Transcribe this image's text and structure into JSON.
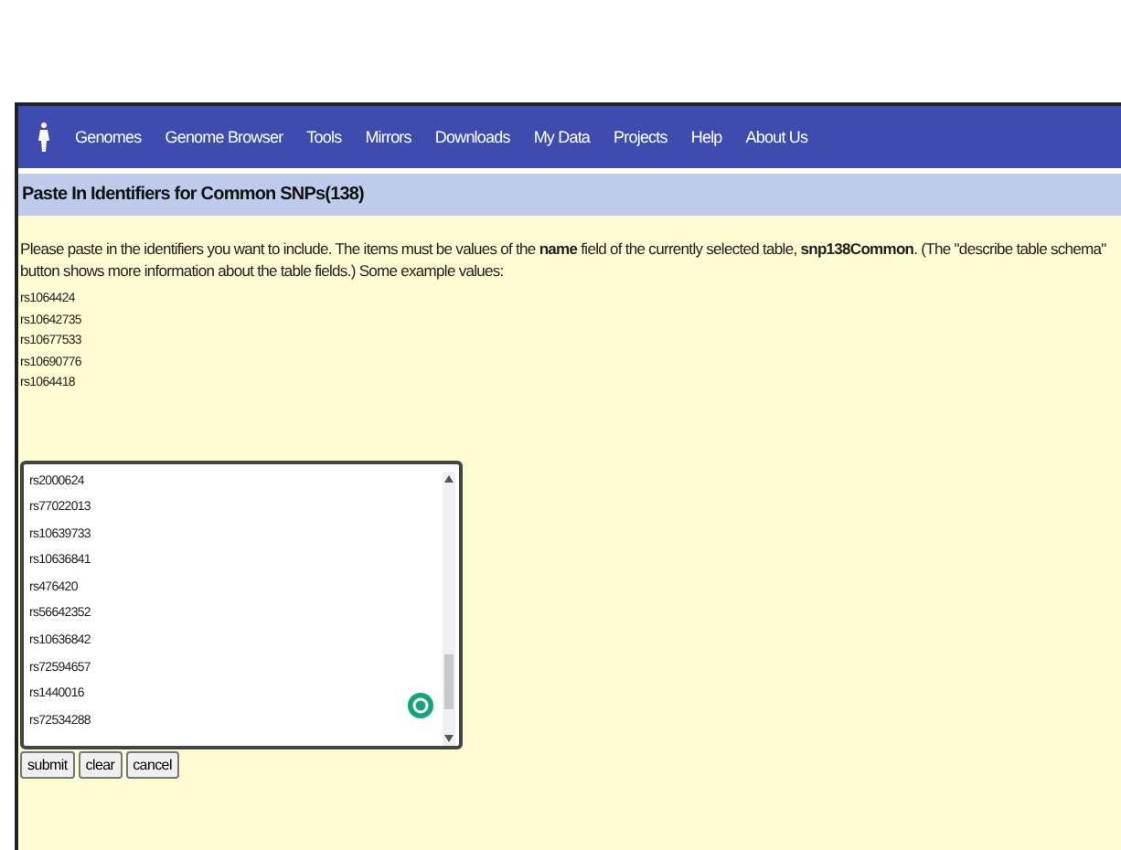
{
  "nav": {
    "items": [
      "Genomes",
      "Genome Browser",
      "Tools",
      "Mirrors",
      "Downloads",
      "My Data",
      "Projects",
      "Help",
      "About Us"
    ]
  },
  "title": "Paste In Identifiers for Common SNPs(138)",
  "instructions": "Please paste in the identifiers you want to include. The items must be values of the **name** field of the currently selected table, **snp138Common**. (The \"describe table schema\" button shows more information about the table fields.) Some example values:",
  "examples": [
    "rs1064424",
    "rs10642735",
    "rs10677533",
    "rs10690776",
    "rs1064418"
  ],
  "identifiers": {
    "lines": [
      "rs2000624",
      "rs77022013",
      "rs10639733",
      "rs10636841",
      "rs476420",
      "rs56642352",
      "rs10636842",
      "rs72594657",
      "rs1440016",
      "rs72534288"
    ]
  },
  "buttons": [
    "submit",
    "clear",
    "cancel"
  ]
}
